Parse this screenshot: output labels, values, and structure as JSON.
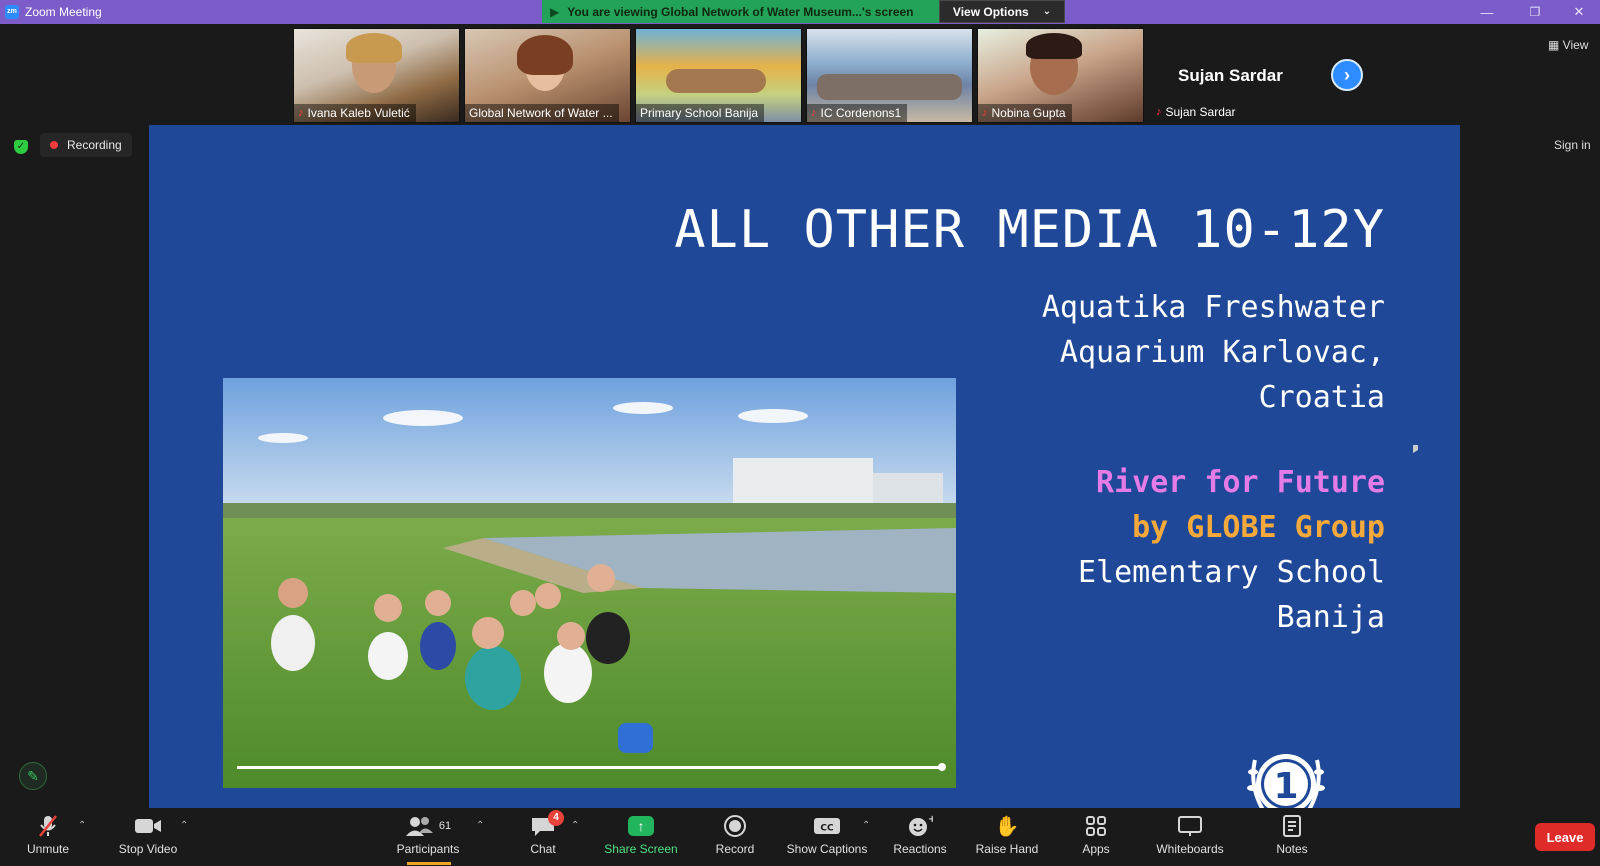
{
  "window": {
    "app_title": "Zoom Meeting",
    "logo_text": "zm",
    "banner_text": "You are viewing Global Network of Water Museum...'s screen",
    "view_options_label": "View Options",
    "minimize_glyph": "—",
    "restore_glyph": "❐",
    "close_glyph": "✕"
  },
  "participants_strip": [
    {
      "name": "Ivana Kaleb Vuletić",
      "muted": true
    },
    {
      "name": "Global Network of Water ...",
      "muted": false
    },
    {
      "name": "Primary School Banija",
      "muted": false
    },
    {
      "name": "IC Cordenons1",
      "muted": true
    },
    {
      "name": "Nobina Gupta",
      "muted": true
    },
    {
      "name": "Sujan Sardar",
      "display_name": "Sujan Sardar",
      "muted": true
    }
  ],
  "side": {
    "view_label": "View",
    "sign_in_label": "Sign in",
    "recording_label": "Recording"
  },
  "slide": {
    "title": "ALL OTHER MEDIA 10-12Y",
    "venue_lines": [
      "Aquatika Freshwater",
      "Aquarium Karlovac,",
      "Croatia"
    ],
    "project_line1": "River for Future",
    "project_line2": "by GLOBE Group",
    "school_lines": [
      "Elementary School",
      "Banija"
    ],
    "badge_number": "1",
    "colors": {
      "background": "#1f4898",
      "pink": "#e47be6",
      "orange": "#f6a93b"
    }
  },
  "toolbar": {
    "unmute": "Unmute",
    "stop_video": "Stop Video",
    "participants": "Participants",
    "participants_count": "61",
    "chat": "Chat",
    "chat_badge": "4",
    "share_screen": "Share Screen",
    "record": "Record",
    "show_captions": "Show Captions",
    "reactions": "Reactions",
    "raise_hand": "Raise Hand",
    "apps": "Apps",
    "whiteboards": "Whiteboards",
    "notes": "Notes",
    "leave": "Leave"
  },
  "icons": {
    "mic_off": "mic-off-icon",
    "video": "video-camera-icon",
    "participants": "people-icon",
    "chat": "chat-bubble-icon",
    "share": "share-arrow-icon",
    "record": "record-icon",
    "captions": "cc-icon",
    "reactions": "smile-plus-icon",
    "raise_hand": "hand-icon",
    "apps": "apps-icon",
    "whiteboard": "whiteboard-icon",
    "notes": "notes-icon",
    "pen": "pencil-icon"
  }
}
